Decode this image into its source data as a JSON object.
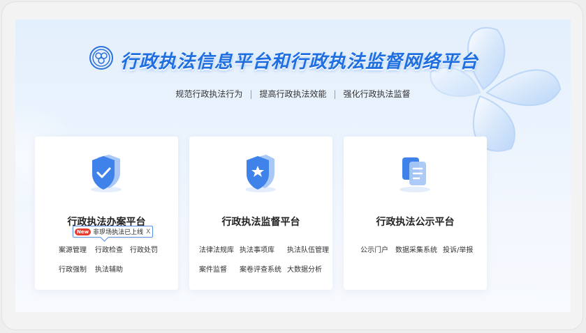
{
  "header": {
    "title": "行政执法信息平台和行政执法监督网络平台",
    "subtitle": [
      "规范行政执法行为",
      "提高行政执法效能",
      "强化行政执法监督"
    ],
    "separator": "|"
  },
  "cards": [
    {
      "title": "行政执法办案平台",
      "icon": "shield-check-icon",
      "tooltip": {
        "tag": "New",
        "text": "非现场执法已上线",
        "close": "X"
      },
      "links": [
        "案源管理",
        "行政检查",
        "行政处罚",
        "行政强制",
        "执法辅助"
      ]
    },
    {
      "title": "行政执法监督平台",
      "icon": "shield-star-icon",
      "links": [
        "法律法规库",
        "执法事项库",
        "执法队伍管理",
        "案件监督",
        "案卷评查系统",
        "大数据分析"
      ]
    },
    {
      "title": "行政执法公示平台",
      "icon": "documents-icon",
      "links": [
        "公示门户",
        "数据采集系统",
        "投诉/举报"
      ]
    }
  ],
  "colors": {
    "title_blue": "#1f6fe0",
    "accent_blue": "#3b82f6",
    "tag_red": "#e63b2e"
  }
}
